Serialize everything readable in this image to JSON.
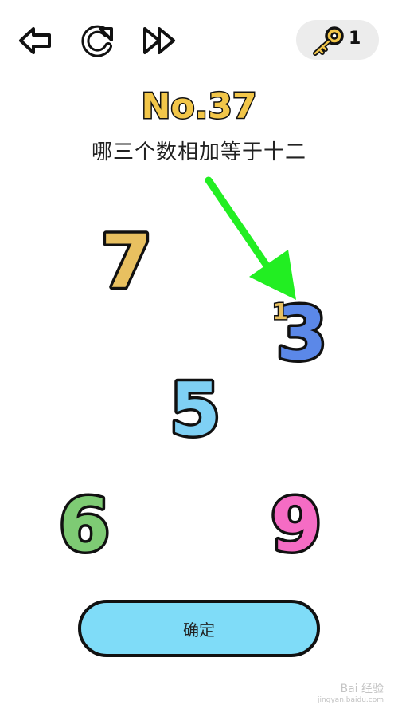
{
  "toolbar": {
    "back_icon": "back-arrow-icon",
    "restart_icon": "restart-icon",
    "skip_icon": "fast-forward-icon",
    "key_icon": "key-icon",
    "key_count": "1"
  },
  "level": {
    "title": "No.37",
    "question": "哪三个数相加等于十二"
  },
  "numbers": [
    {
      "value": "7",
      "color": "#e8c060"
    },
    {
      "value": "3",
      "color": "#5b88e8",
      "superscript": "1"
    },
    {
      "value": "5",
      "color": "#7fd0f4"
    },
    {
      "value": "6",
      "color": "#7ecb74"
    },
    {
      "value": "9",
      "color": "#f56cc4"
    }
  ],
  "colors": {
    "title_fill": "#f2c649",
    "arrow": "#22ee22",
    "confirm_fill": "#7fdcf8"
  },
  "confirm": {
    "label": "确定"
  },
  "watermark": {
    "text": "Bai 经验",
    "sub": "jingyan.baidu.com"
  }
}
